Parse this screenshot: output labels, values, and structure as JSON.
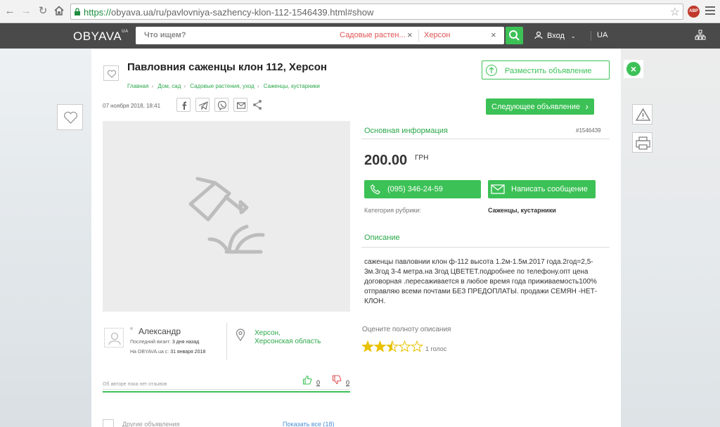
{
  "browser": {
    "url_scheme": "https://",
    "url_rest": "obyava.ua/ru/pavlovniya-sazhency-klon-112-1546439.html#show",
    "adblock_label": "ABP"
  },
  "header": {
    "logo": "OBYAVA",
    "logo_sup": "UA",
    "search_placeholder": "Что ищем?",
    "search_category": "Садовые растен...",
    "search_city": "Херсон",
    "login": "Вход",
    "lang": "UA"
  },
  "ad": {
    "title": "Павловния саженцы клон 112, Херсон",
    "breadcrumbs": [
      "Главная",
      "Дом, сад",
      "Садовые растения, уход",
      "Саженцы, кустарники"
    ],
    "date": "07 ноября 2018, 18:41",
    "place_ad": "Разместить объявление",
    "next_ad": "Следующее объявление",
    "main_info": "Основная информация",
    "ad_id": "#1546439",
    "price": "200.00",
    "currency": "ГРН",
    "phone": "(095) 346-24-59",
    "write_message": "Написать сообщение",
    "category_label": "Категория рубрики:",
    "category_value": "Саженцы, кустарники",
    "description_title": "Описание",
    "description": "саженцы павловнии клон ф-112 высота 1.2м-1.5м.2017 года.2год=2,5-3м.3год 3-4 метра.на 3год ЦВЕТЕТ.подробнее по телефону.опт цена договорная .пересаживается в любое время года приживаемость100% отправляю всеми почтами БЕЗ ПРЕДОПЛАТЫ. продажи СЕМЯН -НЕТ-КЛОН.",
    "rate_question": "Оцените полноту описания",
    "rating": 2.5,
    "votes": "1 голос"
  },
  "seller": {
    "name": "Александр",
    "last_visit_label": "Последний визит:",
    "last_visit": "3 дня назад",
    "since_label": "На OBYAVA.ua с:",
    "since": "31 января 2018",
    "city": "Херсон,",
    "region": "Херсонская область",
    "reviews": "Об авторе пока нет отзывов",
    "likes": "0",
    "dislikes": "0"
  },
  "bottom": {
    "left": "Другие объявления",
    "right": "Показать все (18)"
  },
  "colors": {
    "accent": "#3cc156",
    "link": "#2ba84a",
    "header": "#4a4a4a",
    "search_tag": "#e05252"
  }
}
